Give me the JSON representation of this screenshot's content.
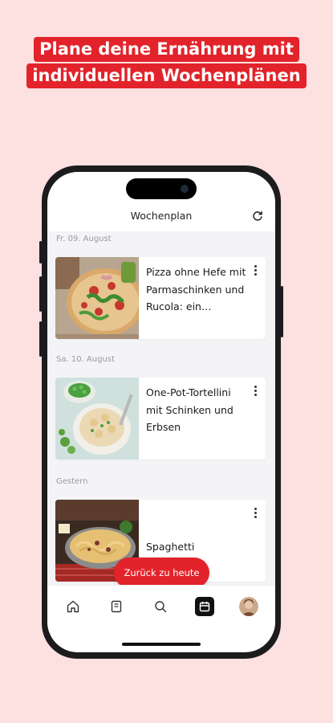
{
  "promo": {
    "line1": "Plane deine Ernährung mit",
    "line2": "individuellen Wochenplänen",
    "accent_color": "#e2232b",
    "background_color": "#fde1e1"
  },
  "header": {
    "title": "Wochenplan",
    "refresh_icon": "refresh-icon"
  },
  "days": [
    {
      "label": "Fr. 09. August",
      "recipe": {
        "title": "Pizza ohne Hefe mit Parmaschinken und Rucola: ein…",
        "menu_icon": "more-vertical-icon"
      }
    },
    {
      "label": "Sa. 10. August",
      "recipe": {
        "title": "One-Pot-Tortellini mit Schinken und Erbsen",
        "menu_icon": "more-vertical-icon"
      }
    },
    {
      "label": "Gestern",
      "recipe": {
        "title": "Spaghetti Carbonara",
        "menu_icon": "more-vertical-icon"
      }
    }
  ],
  "floating_button": {
    "label": "Zurück zu heute"
  },
  "tabbar": {
    "items": [
      {
        "icon": "home-icon",
        "active": false
      },
      {
        "icon": "recipe-book-icon",
        "active": false
      },
      {
        "icon": "search-icon",
        "active": false
      },
      {
        "icon": "calendar-icon",
        "active": true
      },
      {
        "icon": "profile-avatar",
        "active": false
      }
    ]
  }
}
